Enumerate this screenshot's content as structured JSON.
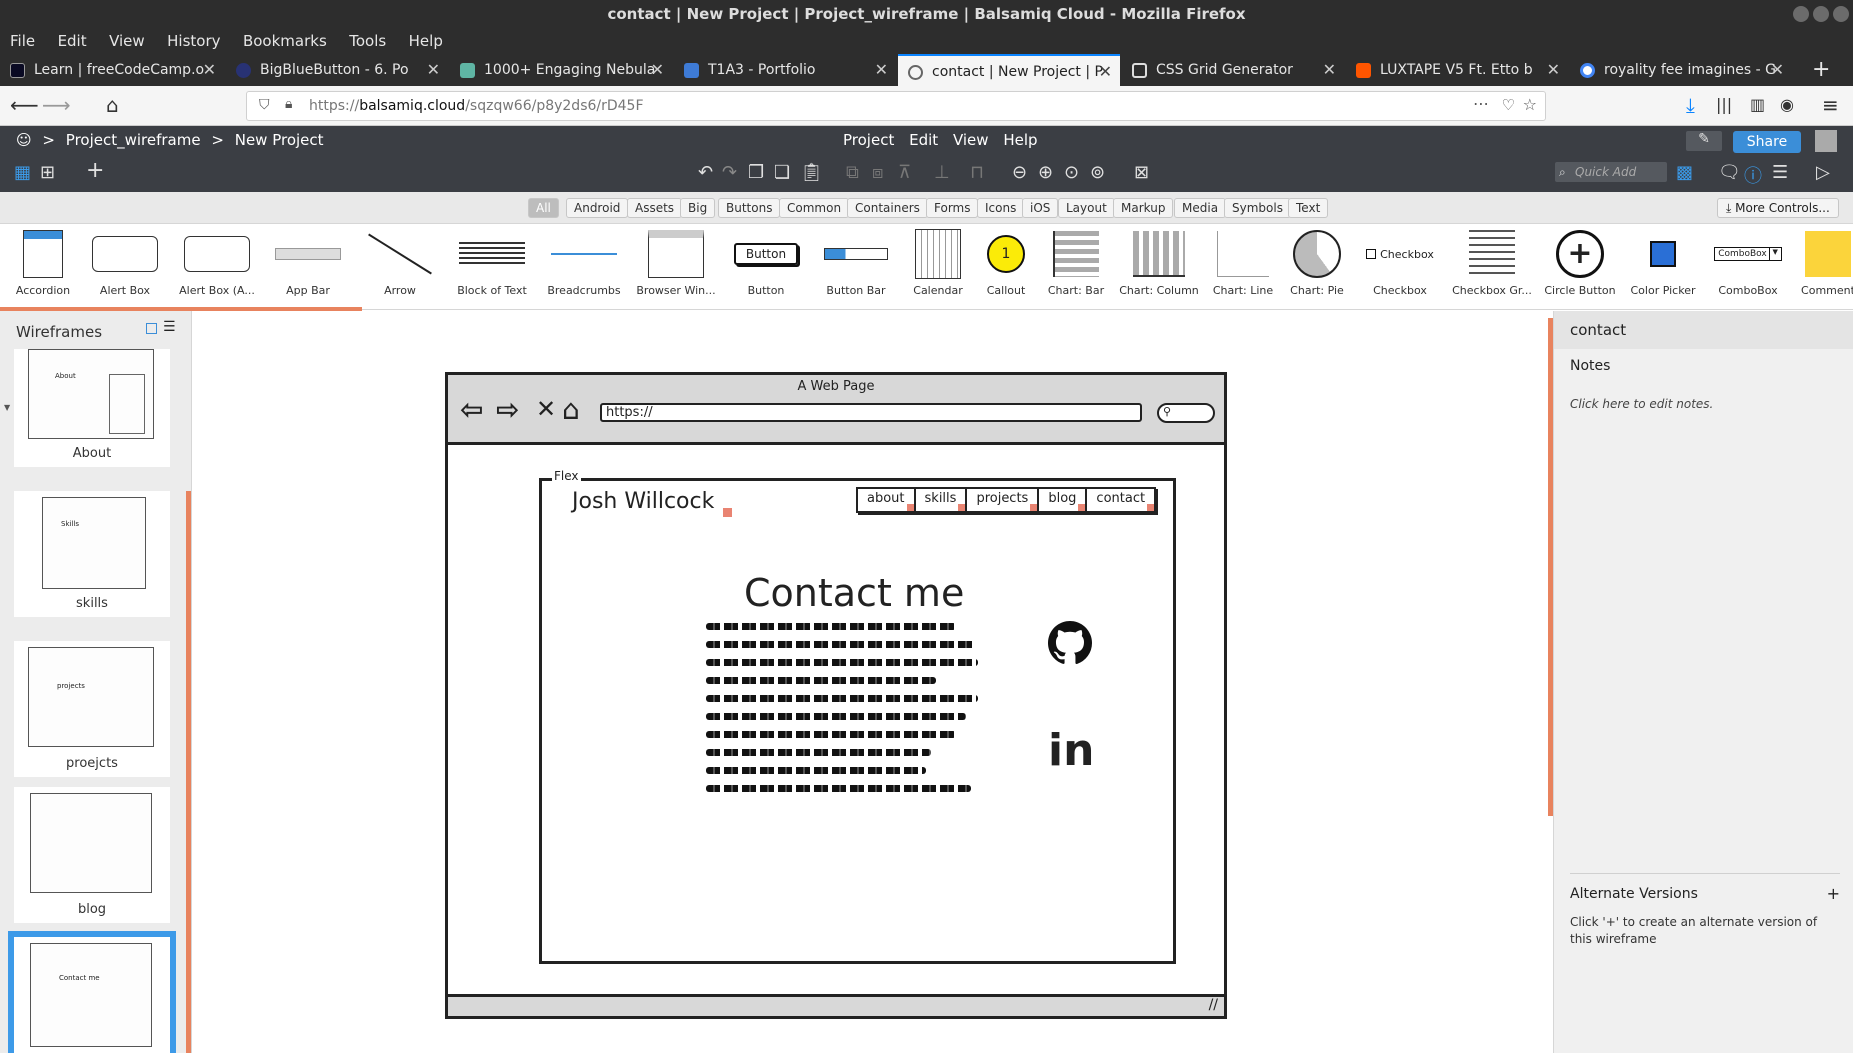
{
  "window": {
    "title": "contact | New Project | Project_wireframe | Balsamiq Cloud - Mozilla Firefox"
  },
  "menubar": [
    "File",
    "Edit",
    "View",
    "History",
    "Bookmarks",
    "Tools",
    "Help"
  ],
  "tabs": [
    {
      "label": "Learn | freeCodeCamp.o",
      "color": "#0a0a23"
    },
    {
      "label": "BigBlueButton - 6. Po",
      "color": "#283274"
    },
    {
      "label": "1000+ Engaging Nebula",
      "color": "#5fb5a4"
    },
    {
      "label": "T1A3 - Portfolio",
      "color": "#3e7bd6"
    },
    {
      "label": "contact | New Project | P",
      "color": "#777777"
    },
    {
      "label": "CSS Grid Generator",
      "color": "#333333"
    },
    {
      "label": "LUXTAPE V5 Ft. Etto b",
      "color": "#ff5500"
    },
    {
      "label": "royality fee imagines - G",
      "color": "#4285f4"
    }
  ],
  "url": {
    "prefix": "https://",
    "domain": "balsamiq.cloud",
    "path": "/sqzqw66/p8y2ds6/rD45F"
  },
  "breadcrumbs": {
    "project": "Project_wireframe",
    "page": "New Project"
  },
  "appmenu": [
    "Project",
    "Edit",
    "View",
    "Help"
  ],
  "toolbar": {
    "quick_add_placeholder": "Quick Add",
    "share_label": "Share"
  },
  "filters": [
    "All",
    "Android",
    "Assets",
    "Big",
    "Buttons",
    "Common",
    "Containers",
    "Forms",
    "Icons",
    "iOS",
    "Layout",
    "Markup",
    "Media",
    "Symbols",
    "Text"
  ],
  "filter_selected": "All",
  "more_controls": "More Controls...",
  "library": [
    "Accordion",
    "Alert Box",
    "Alert Box (A...",
    "App Bar",
    "Arrow",
    "Block of Text",
    "Breadcrumbs",
    "Browser Win...",
    "Button",
    "Button Bar",
    "Calendar",
    "Callout",
    "Chart: Bar",
    "Chart: Column",
    "Chart: Line",
    "Chart: Pie",
    "Checkbox",
    "Checkbox Gr...",
    "Circle Button",
    "Color Picker",
    "ComboBox",
    "Comment"
  ],
  "library_inner": {
    "button": "Button",
    "checkbox": "Checkbox",
    "combobox": "ComboBox",
    "callout": "1"
  },
  "left_panel": {
    "title": "Wireframes",
    "pages": [
      {
        "label": "About",
        "inner": "About"
      },
      {
        "label": "skills",
        "inner": "Skills"
      },
      {
        "label": "proejcts",
        "inner": "projects"
      },
      {
        "label": "blog",
        "inner": ""
      },
      {
        "label": "",
        "inner": "Contact me",
        "selected": true
      }
    ]
  },
  "right_panel": {
    "title": "contact",
    "notes_label": "Notes",
    "notes_hint": "Click here to edit notes.",
    "alt_versions": "Alternate Versions",
    "alt_plus": "+",
    "alt_hint": "Click '+' to create an alternate version of this wireframe"
  },
  "wireframe": {
    "browser_title": "A Web Page",
    "browser_url": "https://",
    "flex_label": "Flex",
    "name": "Josh Willcock",
    "nav": [
      "about",
      "skills",
      "projects",
      "blog",
      "contact"
    ],
    "heading": "Contact me",
    "linkedin": "in"
  }
}
